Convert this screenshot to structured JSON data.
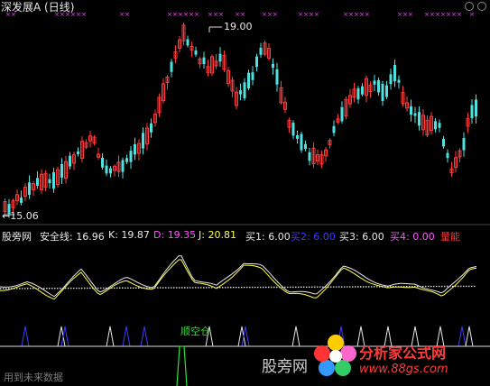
{
  "title": "深发展A (日线)",
  "price_annotations": {
    "high": "19.00",
    "low": "15.06"
  },
  "indicator": {
    "name": "股旁网",
    "fields": [
      {
        "label": "安全线:",
        "value": "16.96",
        "color": "#e8e8e8"
      },
      {
        "label": "K:",
        "value": "19.87",
        "color": "#e8e8e8"
      },
      {
        "label": "D:",
        "value": "19.35",
        "color": "#ff55ff"
      },
      {
        "label": "J:",
        "value": "20.81",
        "color": "#ffff44"
      },
      {
        "label": "买1:",
        "value": "6.00",
        "color": "#e8e8e8"
      },
      {
        "label": "买2:",
        "value": "6.00",
        "color": "#3b3bff"
      },
      {
        "label": "买3:",
        "value": "6.00",
        "color": "#e8e8e8"
      },
      {
        "label": "买4:",
        "value": "0.00",
        "color": "#ff55ff"
      },
      {
        "label": "量能",
        "value": "",
        "color": "#ff3333"
      }
    ]
  },
  "signal_label": "顺空仓",
  "watermarks": {
    "name": "股旁网",
    "data": "用到未来数据"
  },
  "logo": {
    "text": "分析家公式网",
    "url": "www.88gs.com"
  },
  "colors": {
    "up": "#ff3b3b",
    "down": "#4fe0e0",
    "k_line": "#e8e8e8",
    "d_line": "#ffff44",
    "safety": "#dddddd",
    "mark": "#ff44ff"
  }
}
